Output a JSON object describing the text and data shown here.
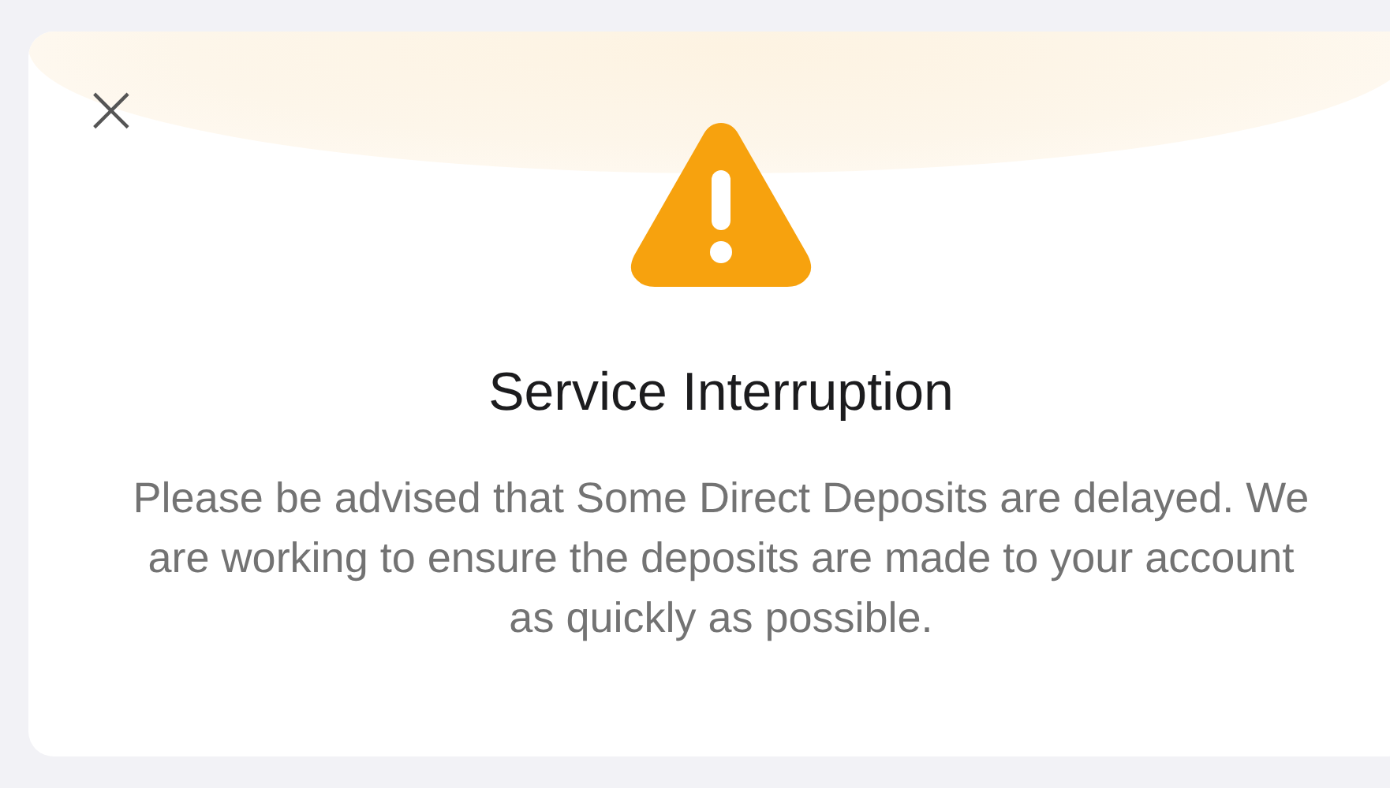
{
  "dialog": {
    "close_label": "×",
    "title": "Service Interruption",
    "message": "Please be advised that Some Direct Deposits are delayed. We are working to ensure the deposits are made to your account as quickly as possible."
  }
}
